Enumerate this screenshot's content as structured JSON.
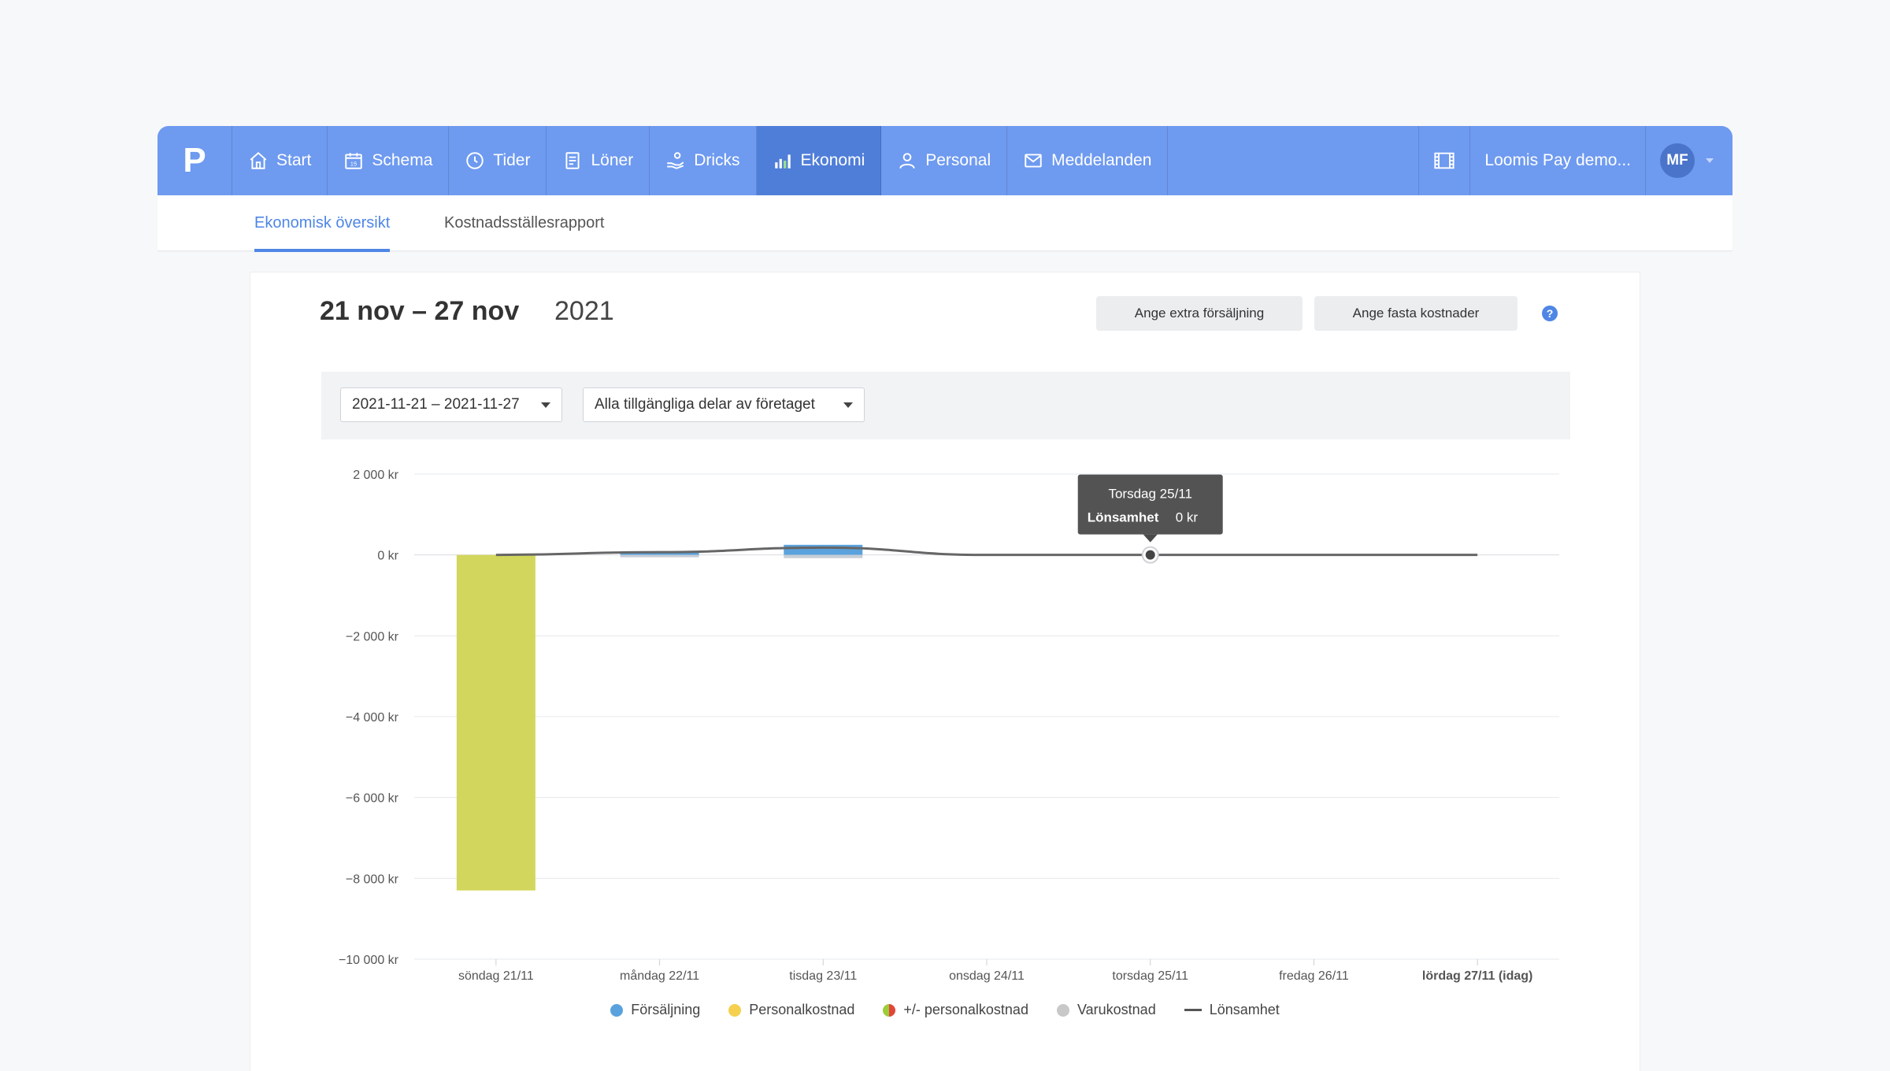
{
  "nav": {
    "logo": "P",
    "items": [
      {
        "label": "Start",
        "icon": "home-icon"
      },
      {
        "label": "Schema",
        "icon": "calendar-icon"
      },
      {
        "label": "Tider",
        "icon": "clock-icon"
      },
      {
        "label": "Löner",
        "icon": "document-icon"
      },
      {
        "label": "Dricks",
        "icon": "hand-coin-icon"
      },
      {
        "label": "Ekonomi",
        "icon": "bar-chart-icon",
        "active": true
      },
      {
        "label": "Personal",
        "icon": "person-icon"
      },
      {
        "label": "Meddelanden",
        "icon": "envelope-icon"
      }
    ],
    "film_icon": "film-icon",
    "account": "Loomis Pay demo...",
    "avatar": "MF"
  },
  "subnav": {
    "tabs": [
      {
        "label": "Ekonomisk översikt",
        "active": true
      },
      {
        "label": "Kostnadsställesrapport"
      }
    ]
  },
  "header": {
    "date_range": "21 nov – 27 nov",
    "year": "2021",
    "btn_extra": "Ange extra försäljning",
    "btn_fixed": "Ange fasta kostnader",
    "help": "?"
  },
  "filters": {
    "period": "2021-11-21 – 2021-11-27",
    "scope": "Alla tillgängliga delar av företaget"
  },
  "tooltip": {
    "title": "Torsdag 25/11",
    "label": "Lönsamhet",
    "value": "0 kr"
  },
  "chart_data": {
    "type": "bar",
    "categories": [
      "söndag 21/11",
      "måndag 22/11",
      "tisdag 23/11",
      "onsdag 24/11",
      "torsdag 25/11",
      "fredag 26/11",
      "lördag 27/11 (idag)"
    ],
    "ylim": [
      -10000,
      2000
    ],
    "yticks": [
      "2 000 kr",
      "0 kr",
      "−2 000 kr",
      "−4 000 kr",
      "−6 000 kr",
      "−8 000 kr",
      "−10 000 kr"
    ],
    "series": [
      {
        "name": "Försäljning",
        "color": "#5aa2dd",
        "values": [
          0,
          60,
          250,
          0,
          0,
          0,
          0
        ]
      },
      {
        "name": "Personalkostnad",
        "color": "#f5d04e",
        "values": [
          -8300,
          0,
          0,
          0,
          0,
          0,
          0
        ]
      },
      {
        "name": "+/- personalkostnad",
        "color": "#e8a33b",
        "values": [
          0,
          0,
          0,
          0,
          0,
          0,
          0
        ]
      },
      {
        "name": "Varukostnad",
        "color": "#c8c8c8",
        "values": [
          0,
          -20,
          -80,
          0,
          0,
          0,
          0
        ]
      },
      {
        "name": "Lönsamhet",
        "color": "#555555",
        "values": [
          0,
          70,
          180,
          0,
          0,
          0,
          0
        ]
      }
    ],
    "legend_position": "bottom"
  }
}
